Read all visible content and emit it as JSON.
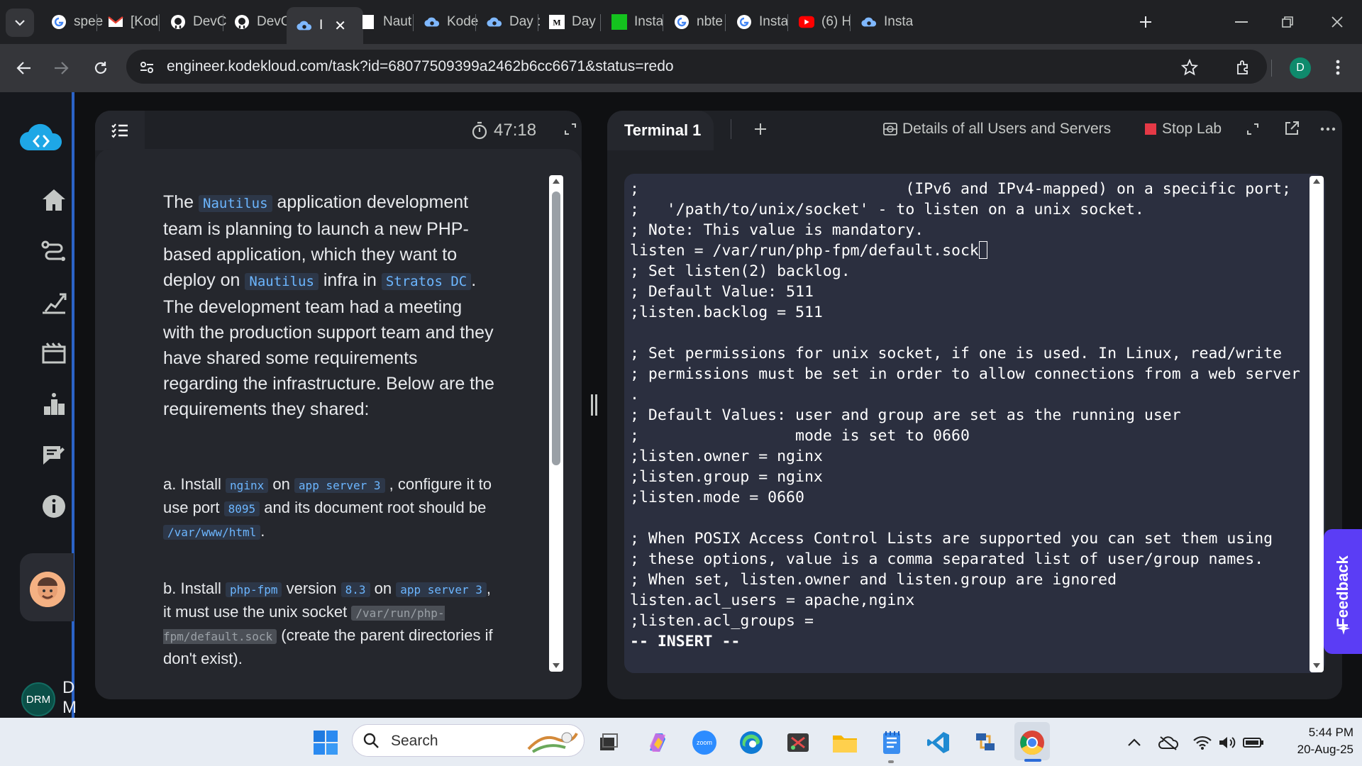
{
  "browser": {
    "tabs": [
      {
        "label": "spee",
        "icon": "google-icon"
      },
      {
        "label": "[Kod",
        "icon": "gmail-icon"
      },
      {
        "label": "DevC",
        "icon": "github-icon"
      },
      {
        "label": "DevC",
        "icon": "github-icon"
      },
      {
        "label": "I",
        "icon": "kodekloud-icon",
        "active": true
      },
      {
        "label": "Naut",
        "icon": "document-icon"
      },
      {
        "label": "Kode",
        "icon": "kodekloud-icon"
      },
      {
        "label": "Day :",
        "icon": "kodekloud-icon"
      },
      {
        "label": "Day",
        "icon": "medium-icon"
      },
      {
        "label": "Insta",
        "icon": "green-site-icon"
      },
      {
        "label": "nbte",
        "icon": "google-icon"
      },
      {
        "label": "Insta",
        "icon": "google-icon"
      },
      {
        "label": "(6) H",
        "icon": "youtube-icon"
      },
      {
        "label": "Insta",
        "icon": "kodekloud-icon"
      }
    ],
    "url": "engineer.kodekloud.com/task?id=68077509399a2462b6cc6671&status=redo",
    "profile_initial": "D"
  },
  "sidebar": {
    "user_badge": "DRM",
    "user_initials": "D\nM"
  },
  "task": {
    "timer": "47:18",
    "desc_parts": [
      {
        "t": "The "
      },
      {
        "c": "Nautilus"
      },
      {
        "t": " application development team is planning to launch a new PHP-based application, which they want to deploy on "
      },
      {
        "c": "Nautilus"
      },
      {
        "t": " infra in "
      },
      {
        "c": "Stratos DC"
      },
      {
        "t": ". The development team had a meeting with the production support team and they have shared some requirements regarding the infrastructure. Below are the requirements they shared:"
      }
    ],
    "req_a": [
      {
        "t": "a. Install "
      },
      {
        "c": "nginx"
      },
      {
        "t": " on "
      },
      {
        "c": "app server 3"
      },
      {
        "t": " , configure it to use port "
      },
      {
        "c": "8095"
      },
      {
        "t": " and its document root should be "
      },
      {
        "c": "/var/www/html"
      },
      {
        "t": "."
      }
    ],
    "req_b": [
      {
        "t": "b. Install "
      },
      {
        "c": "php-fpm"
      },
      {
        "t": " version "
      },
      {
        "c": "8.3"
      },
      {
        "t": " on "
      },
      {
        "c": "app server 3"
      },
      {
        "t": ", it must use the unix socket "
      },
      {
        "g": "/var/run/php-fpm/default.sock"
      },
      {
        "t": " (create the parent directories if don't exist)."
      }
    ]
  },
  "terminal": {
    "tab_label": "Terminal 1",
    "details_label": "Details of all Users and Servers",
    "stop_label": "Stop Lab",
    "lines": [
      ";                             (IPv6 and IPv4-mapped) on a specific port;",
      ";   '/path/to/unix/socket' - to listen on a unix socket.",
      "; Note: This value is mandatory.",
      "listen = /var/run/php-fpm/default.sock",
      "; Set listen(2) backlog.",
      "; Default Value: 511",
      ";listen.backlog = 511",
      "",
      "; Set permissions for unix socket, if one is used. In Linux, read/write",
      "; permissions must be set in order to allow connections from a web server",
      ".",
      "; Default Values: user and group are set as the running user",
      ";                 mode is set to 0660",
      ";listen.owner = nginx",
      ";listen.group = nginx",
      ";listen.mode = 0660",
      "",
      "; When POSIX Access Control Lists are supported you can set them using",
      "; these options, value is a comma separated list of user/group names.",
      "; When set, listen.owner and listen.group are ignored",
      "listen.acl_users = apache,nginx",
      ";listen.acl_groups =",
      "-- INSERT --"
    ],
    "cursor_line": 3
  },
  "feedback_label": "Feedback",
  "taskbar": {
    "search_placeholder": "Search",
    "time": "5:44 PM",
    "date": "20-Aug-25"
  }
}
